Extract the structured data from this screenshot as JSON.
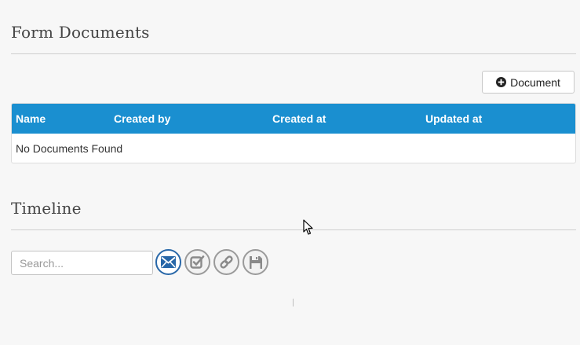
{
  "form_documents": {
    "title": "Form Documents",
    "add_button_label": "Document",
    "add_button_icon": "plus-circle-icon",
    "table": {
      "header_color": "#1a8fd0",
      "columns": [
        "Name",
        "Created by",
        "Created at",
        "Updated at"
      ],
      "empty_message": "No Documents Found"
    }
  },
  "timeline": {
    "title": "Timeline",
    "search": {
      "value": "",
      "placeholder": "Search..."
    },
    "filters": [
      {
        "icon": "email-icon",
        "active": true
      },
      {
        "icon": "task-check-icon",
        "active": false
      },
      {
        "icon": "link-icon",
        "active": false
      },
      {
        "icon": "save-icon",
        "active": false
      }
    ],
    "active_color": "#2867a8",
    "inactive_color": "#9a9a9a"
  }
}
